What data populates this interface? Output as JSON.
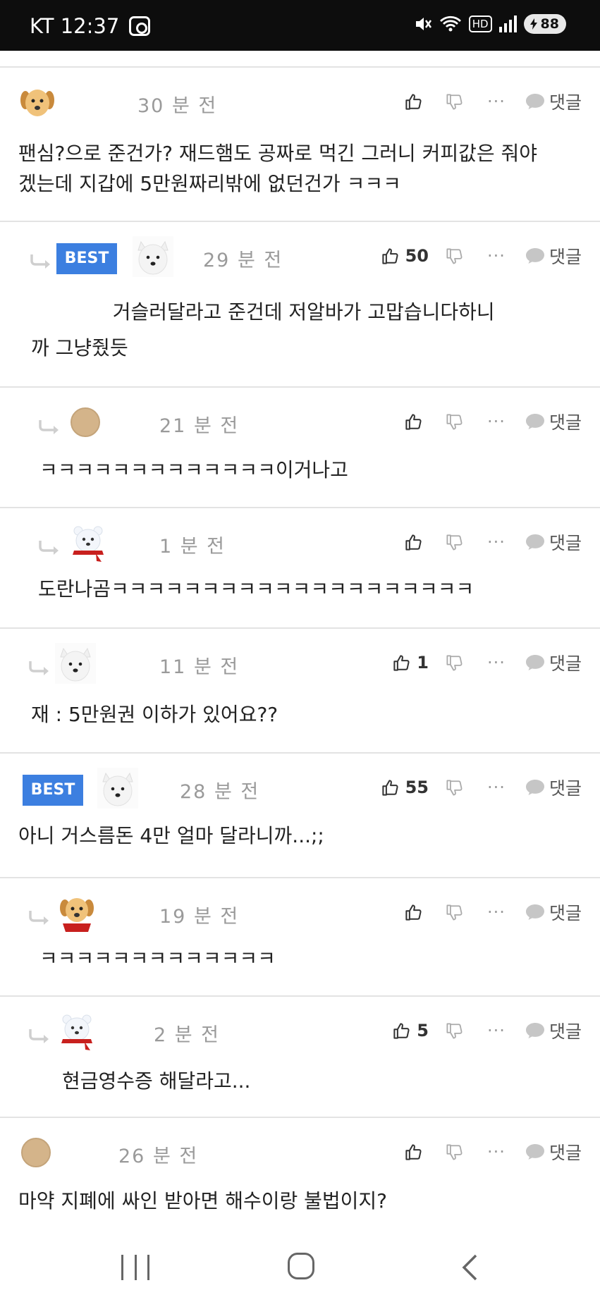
{
  "status_bar": {
    "carrier_time": "KT 12:37",
    "hd": "HD",
    "battery": "88"
  },
  "action_labels": {
    "reply": "댓글",
    "more": "···"
  },
  "best_label": "BEST",
  "comments": [
    {
      "time": "30 분 전",
      "likes": "",
      "text": "팬심?으로 준건가? 재드햄도 공짜로 먹긴 그러니 커피값은 줘야\n겠는데 지갑에 5만원짜리밖에 없던건가 ㅋㅋㅋ",
      "avatar": "puppy-avatar"
    },
    {
      "time": "29 분 전",
      "likes": "50",
      "text": "             거슬러달라고 준건데 저알바가 고맙습니다하니\n까 그냥줬듯",
      "avatar": "white-dog-avatar",
      "best": true
    },
    {
      "time": "21 분 전",
      "likes": "",
      "text": "ㅋㅋㅋㅋㅋㅋㅋㅋㅋㅋㅋㅋㅋ이거나고",
      "avatar": "default-avatar"
    },
    {
      "time": "1 분 전",
      "likes": "",
      "text": "도란나곰ㅋㅋㅋㅋㅋㅋㅋㅋㅋㅋㅋㅋㅋㅋㅋㅋㅋㅋㅋㅋ",
      "avatar": "polar-bear-avatar"
    },
    {
      "time": "11 분 전",
      "likes": "1",
      "text": "재 : 5만원권 이하가 있어요??",
      "avatar": "white-dog-avatar"
    },
    {
      "time": "28 분 전",
      "likes": "55",
      "text": "아니 거스름돈 4만 얼마 달라니까...;;",
      "avatar": "white-dog-avatar",
      "best": true
    },
    {
      "time": "19 분 전",
      "likes": "",
      "text": "ㅋㅋㅋㅋㅋㅋㅋㅋㅋㅋㅋㅋㅋ",
      "avatar": "puppy-scarf-avatar"
    },
    {
      "time": "2 분 전",
      "likes": "5",
      "text": "현금영수증 해달라고...",
      "avatar": "polar-bear-avatar"
    },
    {
      "time": "26 분 전",
      "likes": "",
      "text": "마약 지폐에 싸인 받아면 해수이랑 불법이지?",
      "avatar": "default-avatar"
    }
  ]
}
